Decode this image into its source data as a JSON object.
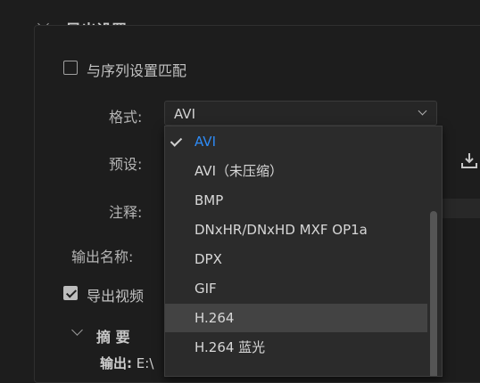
{
  "export_settings": {
    "title": "导出设置",
    "match_sequence_label": "与序列设置匹配",
    "format_label": "格式:",
    "format_value": "AVI",
    "preset_label": "预设:",
    "comment_label": "注释:",
    "output_name_label": "输出名称:",
    "export_video_label": "导出视频",
    "summary_title": "摘 要",
    "output_prefix": "输出:",
    "output_value": "E:\\"
  },
  "format_dropdown": {
    "options": [
      {
        "label": "AVI",
        "selected": true
      },
      {
        "label": "AVI（未压缩）"
      },
      {
        "label": "BMP"
      },
      {
        "label": "DNxHR/DNxHD MXF OP1a"
      },
      {
        "label": "DPX"
      },
      {
        "label": "GIF"
      },
      {
        "label": "H.264",
        "hover": true
      },
      {
        "label": "H.264 蓝光"
      }
    ]
  },
  "colors": {
    "accent": "#2e8bf5",
    "background": "#1d1d1d"
  }
}
